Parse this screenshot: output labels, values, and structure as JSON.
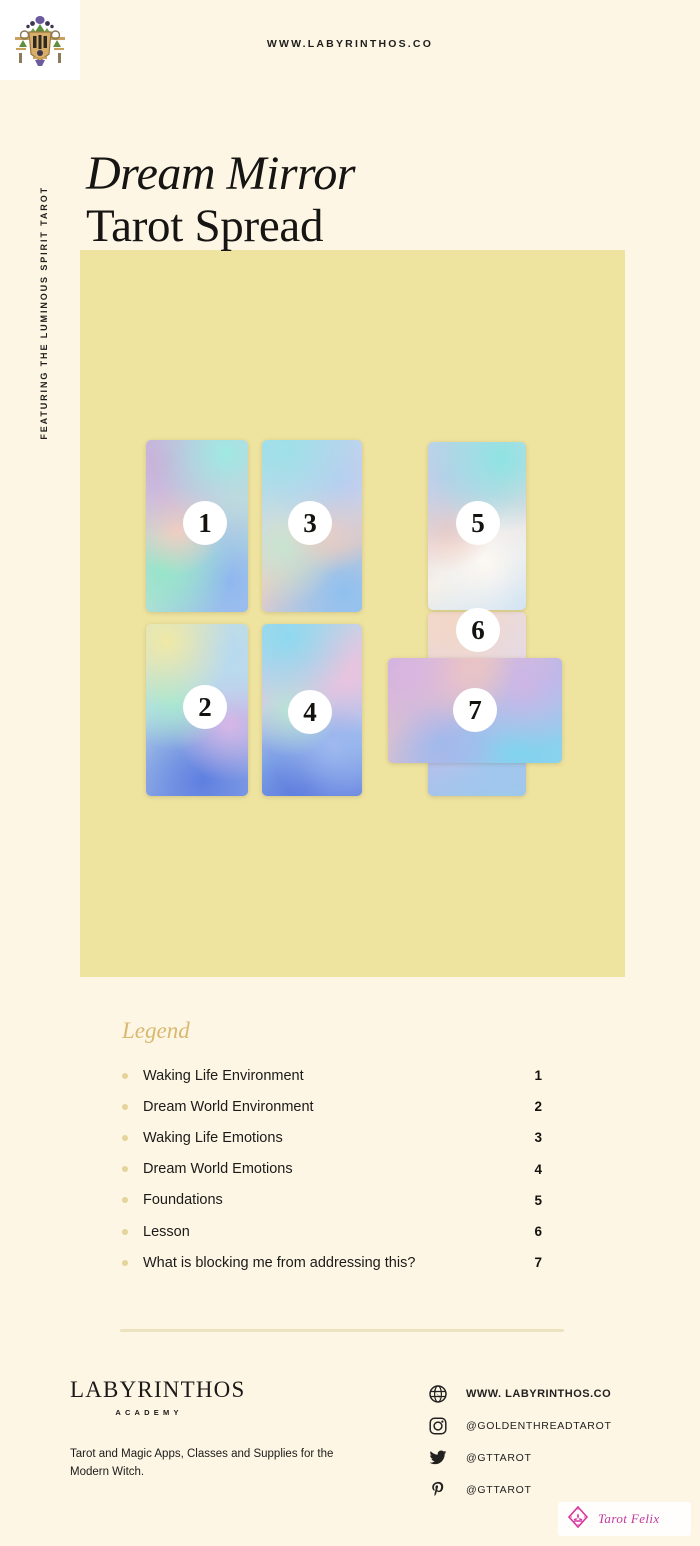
{
  "header": {
    "url": "WWW.LABYRINTHOS.CO",
    "logo_icon": "labyrinthos-emblem-icon"
  },
  "side_label": "FEATURING THE LUMINOUS SPIRIT TAROT",
  "title": {
    "line1": "Dream Mirror",
    "line2": "Tarot Spread"
  },
  "spread": {
    "cards": [
      {
        "number": "1",
        "orientation": "vertical"
      },
      {
        "number": "2",
        "orientation": "vertical"
      },
      {
        "number": "3",
        "orientation": "vertical"
      },
      {
        "number": "4",
        "orientation": "vertical"
      },
      {
        "number": "5",
        "orientation": "vertical"
      },
      {
        "number": "6",
        "orientation": "vertical"
      },
      {
        "number": "7",
        "orientation": "horizontal"
      }
    ]
  },
  "legend": {
    "title": "Legend",
    "items": [
      {
        "label": "Waking Life Environment",
        "number": "1"
      },
      {
        "label": "Dream World Environment",
        "number": "2"
      },
      {
        "label": "Waking Life Emotions",
        "number": "3"
      },
      {
        "label": "Dream World Emotions",
        "number": "4"
      },
      {
        "label": "Foundations",
        "number": "5"
      },
      {
        "label": "Lesson",
        "number": "6"
      },
      {
        "label": "What is blocking me from addressing this?",
        "number": "7"
      }
    ]
  },
  "footer": {
    "brand": "LABYRINTHOS",
    "brand_sub": "ACADEMY",
    "tagline": "Tarot and Magic Apps, Classes and Supplies for the Modern Witch.",
    "social": [
      {
        "icon": "globe-icon",
        "text": "WWW. LABYRINTHOS.CO",
        "strong": true
      },
      {
        "icon": "instagram-icon",
        "text": "@GOLDENTHREADTAROT",
        "strong": false
      },
      {
        "icon": "twitter-icon",
        "text": "@GTTAROT",
        "strong": false
      },
      {
        "icon": "pinterest-icon",
        "text": "@GTTAROT",
        "strong": false
      }
    ]
  },
  "watermark": {
    "text": "Tarot Felix",
    "icon": "lotus-diamond-icon"
  },
  "colors": {
    "background": "#FDF6E5",
    "panel": "#EFE3A0",
    "gold": "#D9B870",
    "divider": "#EDE2BE",
    "ink": "#161513",
    "watermark_pink": "#C2379C"
  }
}
